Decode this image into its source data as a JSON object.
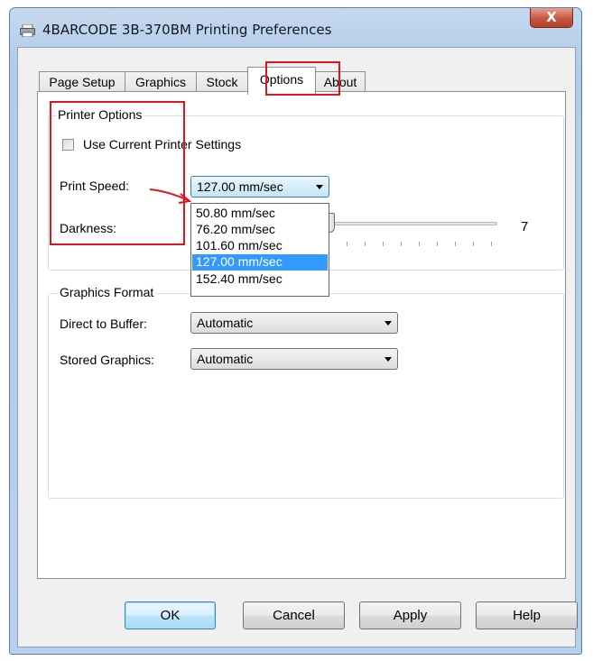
{
  "window": {
    "title": "4BARCODE 3B-370BM Printing Preferences",
    "close_glyph": "X"
  },
  "tabs": [
    {
      "label": "Page Setup",
      "active": false
    },
    {
      "label": "Graphics",
      "active": false
    },
    {
      "label": "Stock",
      "active": false
    },
    {
      "label": "Options",
      "active": true
    },
    {
      "label": "About",
      "active": false
    }
  ],
  "printer_options": {
    "legend": "Printer Options",
    "use_current_label": "Use Current Printer Settings",
    "use_current_checked": false,
    "print_speed_label": "Print Speed:",
    "print_speed_value": "127.00 mm/sec",
    "speed_options": [
      "50.80 mm/sec",
      "76.20 mm/sec",
      "101.60 mm/sec",
      "127.00 mm/sec",
      "152.40 mm/sec"
    ],
    "selected_speed_index": 3,
    "darkness_label": "Darkness:",
    "darkness_value": "7"
  },
  "graphics_format": {
    "legend": "Graphics Format",
    "direct_to_buffer_label": "Direct to Buffer:",
    "direct_to_buffer_value": "Automatic",
    "stored_graphics_label": "Stored Graphics:",
    "stored_graphics_value": "Automatic"
  },
  "buttons": {
    "ok": "OK",
    "cancel": "Cancel",
    "apply": "Apply",
    "help": "Help"
  },
  "colors": {
    "annotation": "#e0141e",
    "selection": "#3399ff"
  }
}
